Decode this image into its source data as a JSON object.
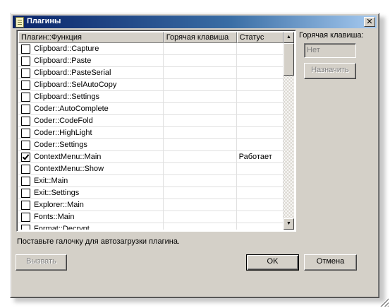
{
  "window": {
    "title": "Плагины",
    "close_glyph": "✕",
    "title_icon": "notepad-icon"
  },
  "table": {
    "columns": [
      "Плагин::Функция",
      "Горячая клавиша",
      "Статус"
    ],
    "rows": [
      {
        "name": "Clipboard::Capture",
        "hotkey": "",
        "status": "",
        "checked": false
      },
      {
        "name": "Clipboard::Paste",
        "hotkey": "",
        "status": "",
        "checked": false
      },
      {
        "name": "Clipboard::PasteSerial",
        "hotkey": "",
        "status": "",
        "checked": false
      },
      {
        "name": "Clipboard::SelAutoCopy",
        "hotkey": "",
        "status": "",
        "checked": false
      },
      {
        "name": "Clipboard::Settings",
        "hotkey": "",
        "status": "",
        "checked": false
      },
      {
        "name": "Coder::AutoComplete",
        "hotkey": "",
        "status": "",
        "checked": false
      },
      {
        "name": "Coder::CodeFold",
        "hotkey": "",
        "status": "",
        "checked": false
      },
      {
        "name": "Coder::HighLight",
        "hotkey": "",
        "status": "",
        "checked": false
      },
      {
        "name": "Coder::Settings",
        "hotkey": "",
        "status": "",
        "checked": false
      },
      {
        "name": "ContextMenu::Main",
        "hotkey": "",
        "status": "Работает",
        "checked": true
      },
      {
        "name": "ContextMenu::Show",
        "hotkey": "",
        "status": "",
        "checked": false
      },
      {
        "name": "Exit::Main",
        "hotkey": "",
        "status": "",
        "checked": false
      },
      {
        "name": "Exit::Settings",
        "hotkey": "",
        "status": "",
        "checked": false
      },
      {
        "name": "Explorer::Main",
        "hotkey": "",
        "status": "",
        "checked": false
      },
      {
        "name": "Fonts::Main",
        "hotkey": "",
        "status": "",
        "checked": false
      },
      {
        "name": "Format::Decrypt",
        "hotkey": "",
        "status": "",
        "checked": false
      }
    ]
  },
  "hint": "Поставьте галочку для автозагрузки плагина.",
  "hotkey_panel": {
    "label": "Горячая клавиша:",
    "value": "Нет",
    "assign_label": "Назначить"
  },
  "buttons": {
    "call": "Вызвать",
    "ok": "OK",
    "cancel": "Отмена"
  },
  "scrollbar": {
    "up_glyph": "▲",
    "down_glyph": "▼"
  },
  "colors": {
    "titlebar_start": "#0a246a",
    "titlebar_end": "#a6caf0",
    "face": "#d4d0c8"
  }
}
